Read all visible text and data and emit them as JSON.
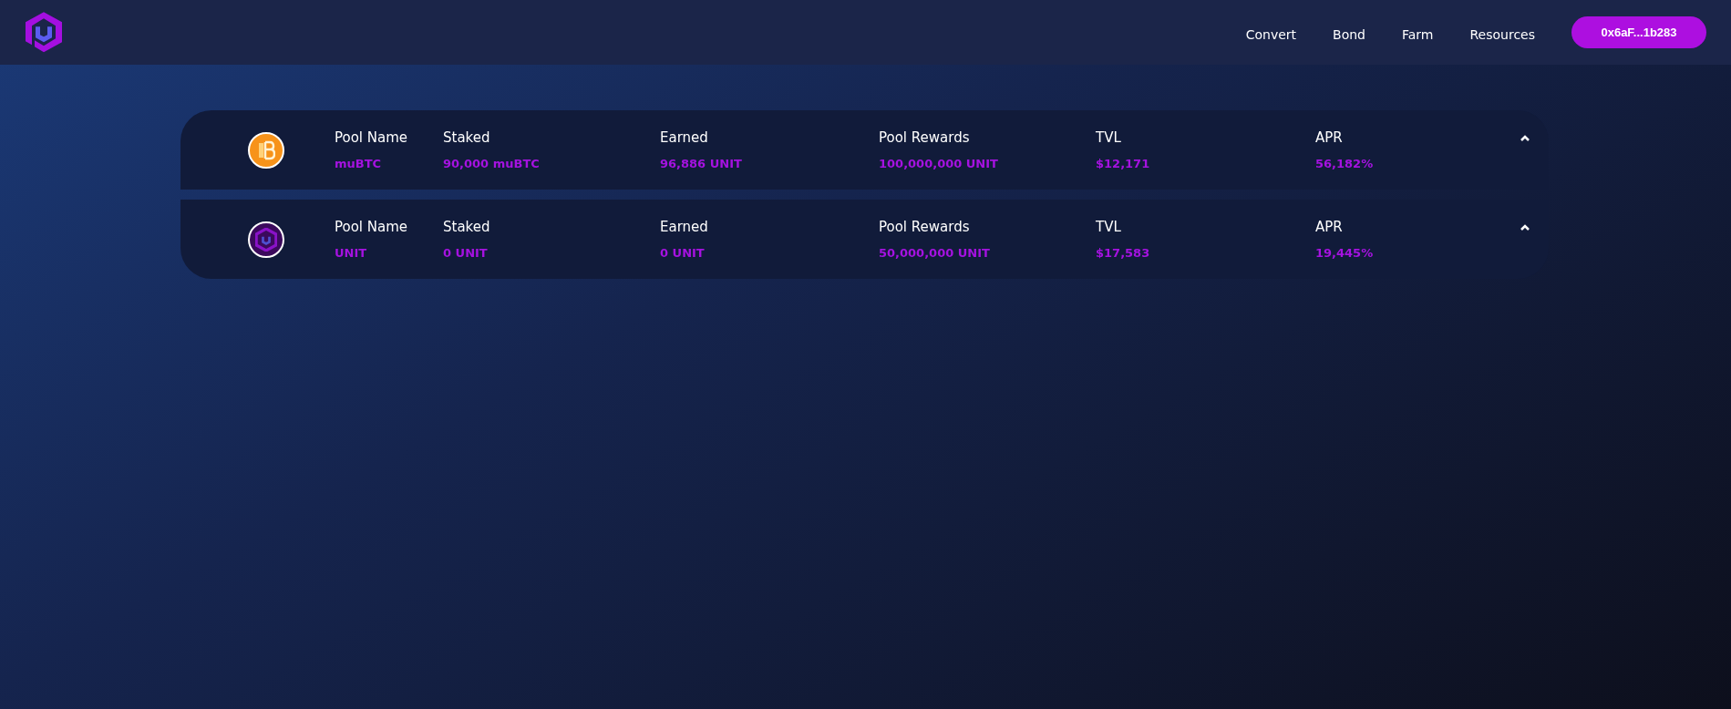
{
  "nav": {
    "links": [
      "Convert",
      "Bond",
      "Farm",
      "Resources"
    ],
    "wallet": "0x6aF...1b283"
  },
  "pools": [
    {
      "kind": "btc",
      "fields": [
        {
          "label": "Pool Name",
          "value": "muBTC"
        },
        {
          "label": "Staked",
          "value": "90,000 muBTC"
        },
        {
          "label": "Earned",
          "value": "96,886 UNIT"
        },
        {
          "label": "Pool Rewards",
          "value": "100,000,000 UNIT"
        },
        {
          "label": "TVL",
          "value": "$12,171"
        },
        {
          "label": "APR",
          "value": "56,182%"
        }
      ]
    },
    {
      "kind": "unit",
      "fields": [
        {
          "label": "Pool Name",
          "value": "UNIT"
        },
        {
          "label": "Staked",
          "value": "0 UNIT"
        },
        {
          "label": "Earned",
          "value": "0 UNIT"
        },
        {
          "label": "Pool Rewards",
          "value": "50,000,000 UNIT"
        },
        {
          "label": "TVL",
          "value": "$17,583"
        },
        {
          "label": "APR",
          "value": "19,445%"
        }
      ]
    }
  ]
}
